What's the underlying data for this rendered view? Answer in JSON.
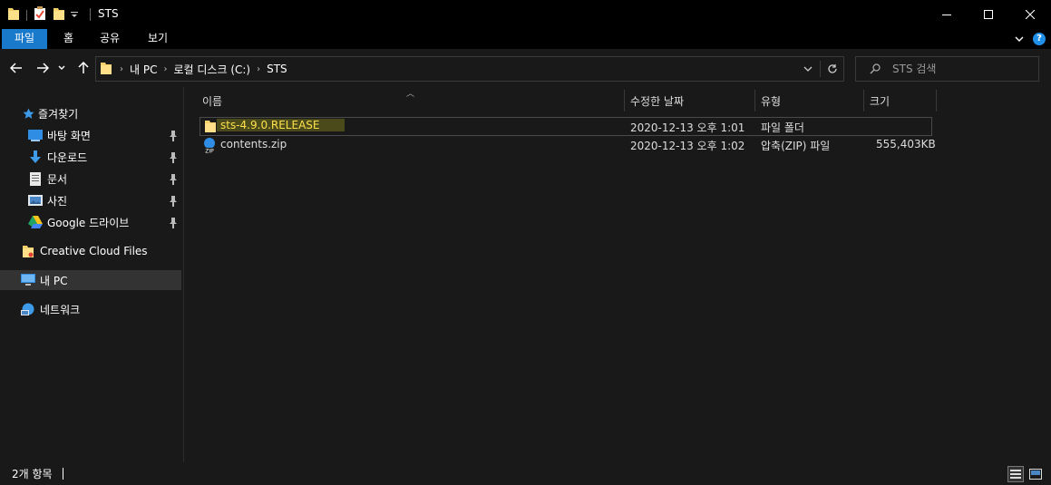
{
  "window": {
    "title": "STS",
    "controls": {
      "minimize": "minimize-icon",
      "maximize": "maximize-icon",
      "close": "close-icon"
    }
  },
  "ribbon": {
    "tabs": [
      {
        "label": "파일",
        "active": true
      },
      {
        "label": "홈"
      },
      {
        "label": "공유"
      },
      {
        "label": "보기"
      }
    ],
    "help": "?"
  },
  "address": {
    "crumbs": [
      "내 PC",
      "로컬 디스크 (C:)",
      "STS"
    ]
  },
  "search": {
    "placeholder": "STS 검색"
  },
  "nav": {
    "quick_access": "즐겨찾기",
    "pinned": [
      {
        "label": "바탕 화면",
        "icon": "desktop-icon"
      },
      {
        "label": "다운로드",
        "icon": "download-icon"
      },
      {
        "label": "문서",
        "icon": "documents-icon"
      },
      {
        "label": "사진",
        "icon": "pictures-icon"
      },
      {
        "label": "Google 드라이브",
        "icon": "google-drive-icon"
      }
    ],
    "creative_cloud": "Creative Cloud Files",
    "this_pc": "내 PC",
    "network": "네트워크"
  },
  "columns": {
    "name": "이름",
    "modified": "수정한 날짜",
    "type": "유형",
    "size": "크기"
  },
  "files": [
    {
      "name": "sts-4.9.0.RELEASE",
      "modified": "2020-12-13 오후 1:01",
      "type": "파일 폴더",
      "size": "",
      "icon": "folder-icon"
    },
    {
      "name": "contents.zip",
      "modified": "2020-12-13 오후 1:02",
      "type": "압축(ZIP) 파일",
      "size": "555,403KB",
      "icon": "zip-icon"
    }
  ],
  "status": {
    "count": "2개 항목"
  },
  "colors": {
    "accent": "#1979ca",
    "background": "#191919",
    "highlight_text": "#ffe14a"
  }
}
